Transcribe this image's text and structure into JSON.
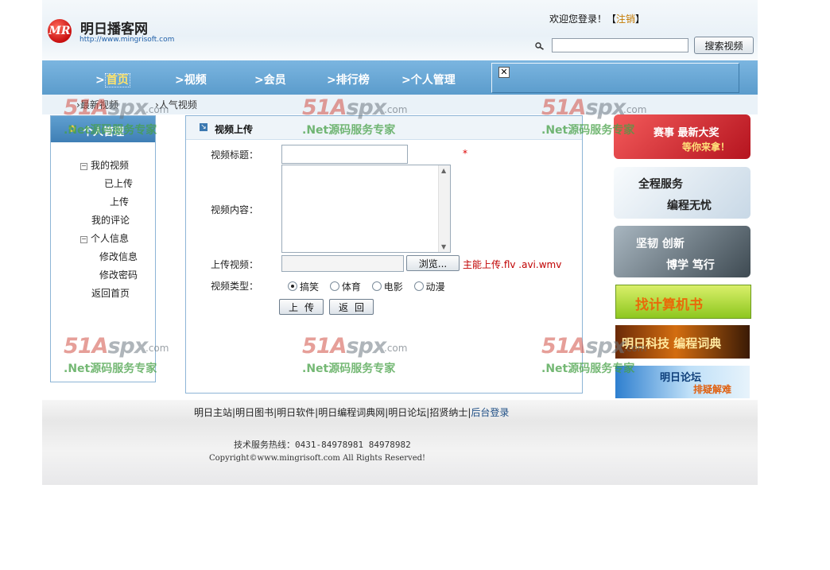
{
  "header": {
    "logo_mark": "MR",
    "site_title": "明日播客网",
    "site_url": "http://www.mingrisoft.com",
    "welcome": "欢迎您登录！",
    "bracket_open": "【",
    "register": "注销",
    "bracket_close": "】",
    "search_placeholder": "",
    "search_button": "搜索视频"
  },
  "nav": {
    "items": [
      {
        "prefix": ">",
        "label": "首页"
      },
      {
        "prefix": ">",
        "label": "视频"
      },
      {
        "prefix": ">",
        "label": "会员"
      },
      {
        "prefix": ">",
        "label": "排行榜"
      },
      {
        "prefix": ">",
        "label": "个人管理"
      }
    ],
    "close_glyph": "✕"
  },
  "subnav": {
    "items": [
      {
        "prefix": "›",
        "label": "最新视频"
      },
      {
        "prefix": "›",
        "label": "人气视频"
      }
    ]
  },
  "left_panel": {
    "title": "个人管理",
    "tree": {
      "my_videos": {
        "toggle": "−",
        "label": "我的视频"
      },
      "uploaded": "已上传",
      "upload": "上传",
      "my_comments": "我的评论",
      "personal_info": {
        "toggle": "−",
        "label": "个人信息"
      },
      "edit_info": "修改信息",
      "change_password": "修改密码",
      "back_home": "返回首页"
    }
  },
  "form": {
    "title": "视频上传",
    "title_label": "视频标题：",
    "required_mark": "*",
    "content_label": "视频内容：",
    "upload_label": "上传视频：",
    "browse_button": "浏览...",
    "upload_hint": "主能上传.flv .avi.wmv",
    "type_label": "视频类型：",
    "types": [
      {
        "label": "搞笑",
        "checked": true
      },
      {
        "label": "体育",
        "checked": false
      },
      {
        "label": "电影",
        "checked": false
      },
      {
        "label": "动漫",
        "checked": false
      }
    ],
    "submit_button": "上传",
    "back_button": "返回"
  },
  "banners": [
    {
      "line1": "赛事 最新大奖",
      "line2": "等你来拿！"
    },
    {
      "line1": "全程服务",
      "line2": "编程无忧"
    },
    {
      "line1": "坚韧 创新",
      "line2": "博学 笃行"
    },
    {
      "line1": "找计算机书"
    },
    {
      "line1": "明日科技 编程词典"
    },
    {
      "line1": "明日论坛",
      "line2": "排疑解难"
    }
  ],
  "footer": {
    "links": [
      "明日主站",
      "明日图书",
      "明日软件",
      "明日编程词典网",
      "明日论坛",
      "招贤纳士",
      "后台登录"
    ],
    "separator": "|",
    "tel": "技术服务热线：0431-84978981  84978982",
    "copyright": "Copyright©www.mingrisoft.com All Rights Reserved!"
  },
  "watermark": {
    "brand_a": "51A",
    "brand_b": "spx",
    "domain": ".com",
    "slogan": ".Net源码服务专家"
  },
  "colors": {
    "nav_blue": "#6aa9d8",
    "active_nav": "#ffe36b",
    "hint_red": "#c00000",
    "watermark_green": "#46a046"
  }
}
